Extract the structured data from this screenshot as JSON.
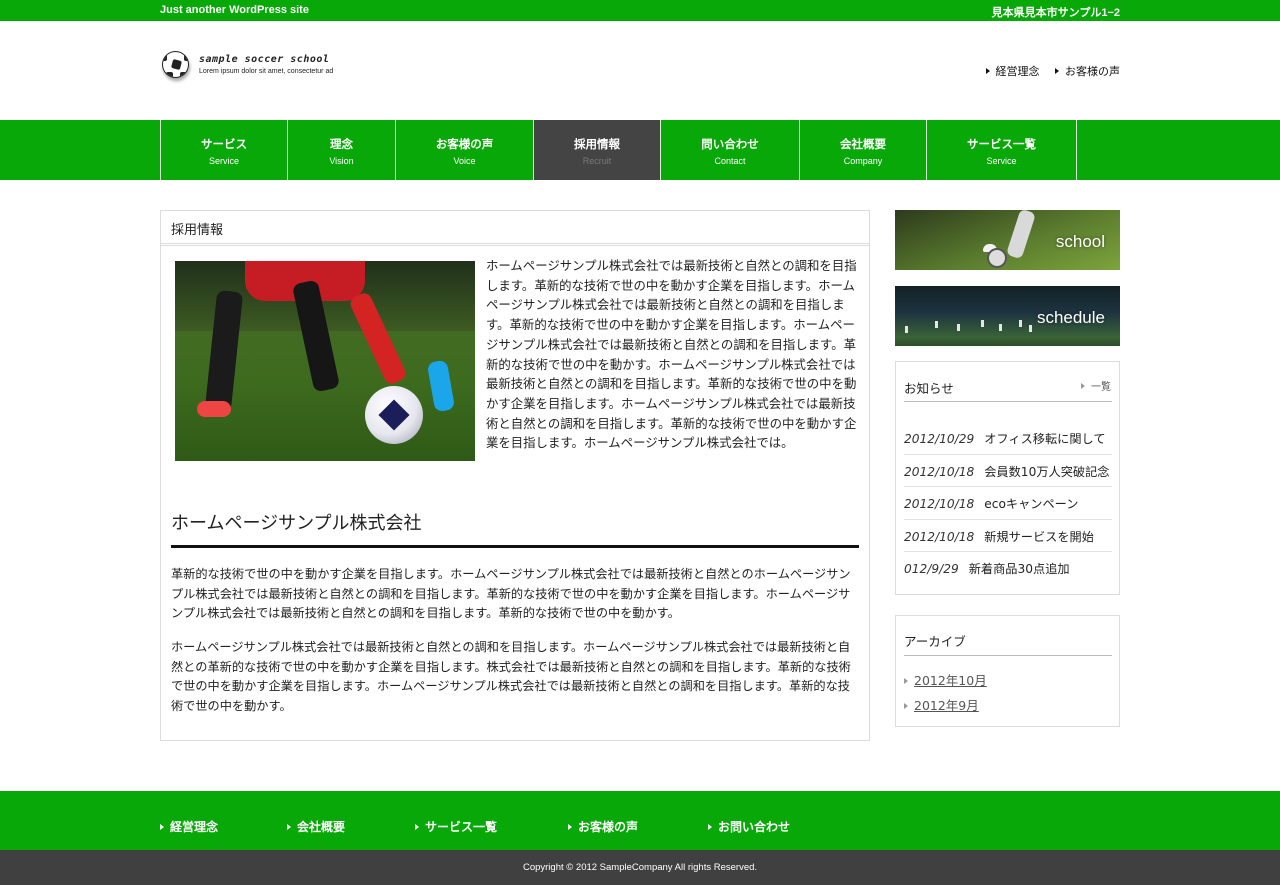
{
  "topbar": {
    "tagline": "Just another WordPress site",
    "address": "見本県見本市サンプル1−2"
  },
  "logo": {
    "name": "sample soccer school",
    "tagline": "Lorem ipsum dolor sit amet, consectetur ad"
  },
  "header_links": [
    {
      "label": "経営理念"
    },
    {
      "label": "お客様の声"
    }
  ],
  "nav": [
    {
      "jp": "サービス",
      "en": "Service"
    },
    {
      "jp": "理念",
      "en": "Vision"
    },
    {
      "jp": "お客様の声",
      "en": "Voice"
    },
    {
      "jp": "採用情報",
      "en": "Recruit",
      "active": true
    },
    {
      "jp": "問い合わせ",
      "en": "Contact"
    },
    {
      "jp": "会社概要",
      "en": "Company"
    },
    {
      "jp": "サービス一覧",
      "en": "Service"
    }
  ],
  "main": {
    "title": "採用情報",
    "intro": "ホームページサンプル株式会社では最新技術と自然との調和を目指します。革新的な技術で世の中を動かす企業を目指します。ホームページサンプル株式会社では最新技術と自然との調和を目指します。革新的な技術で世の中を動かす企業を目指します。ホームページサンプル株式会社では最新技術と自然との調和を目指します。革新的な技術で世の中を動かす。ホームページサンプル株式会社では最新技術と自然との調和を目指します。革新的な技術で世の中を動かす企業を目指します。ホームページサンプル株式会社では最新技術と自然との調和を目指します。革新的な技術で世の中を動かす企業を目指します。ホームページサンプル株式会社では。",
    "subheading": "ホームページサンプル株式会社",
    "paragraph1": "革新的な技術で世の中を動かす企業を目指します。ホームページサンプル株式会社では最新技術と自然とのホームページサンプル株式会社では最新技術と自然との調和を目指します。革新的な技術で世の中を動かす企業を目指します。ホームページサンプル株式会社では最新技術と自然との調和を目指します。革新的な技術で世の中を動かす。",
    "paragraph2": "ホームページサンプル株式会社では最新技術と自然との調和を目指します。ホームページサンプル株式会社では最新技術と自然との革新的な技術で世の中を動かす企業を目指します。株式会社では最新技術と自然との調和を目指します。革新的な技術で世の中を動かす企業を目指します。ホームページサンプル株式会社では最新技術と自然との調和を目指します。革新的な技術で世の中を動かす。"
  },
  "sidebar": {
    "banners": [
      {
        "label": "school"
      },
      {
        "label": "schedule"
      }
    ],
    "news": {
      "title": "お知らせ",
      "more": "一覧",
      "items": [
        {
          "date": "2012/10/29",
          "text": "オフィス移転に関して"
        },
        {
          "date": "2012/10/18",
          "text": "会員数10万人突破記念"
        },
        {
          "date": "2012/10/18",
          "text": "ecoキャンペーン"
        },
        {
          "date": "2012/10/18",
          "text": "新規サービスを開始"
        },
        {
          "date": "012/9/29",
          "text": "新着商品30点追加"
        }
      ]
    },
    "archive": {
      "title": "アーカイブ",
      "items": [
        {
          "label": "2012年10月"
        },
        {
          "label": "2012年9月"
        }
      ]
    }
  },
  "footer": {
    "links": [
      {
        "label": "経営理念"
      },
      {
        "label": "会社概要"
      },
      {
        "label": "サービス一覧"
      },
      {
        "label": "お客様の声"
      },
      {
        "label": "お問い合わせ"
      }
    ],
    "copyright": "Copyright © 2012 SampleCompany All rights Reserved."
  },
  "colors": {
    "brand_green": "#07a807",
    "nav_active": "#444444",
    "footer_dark": "#404040"
  }
}
